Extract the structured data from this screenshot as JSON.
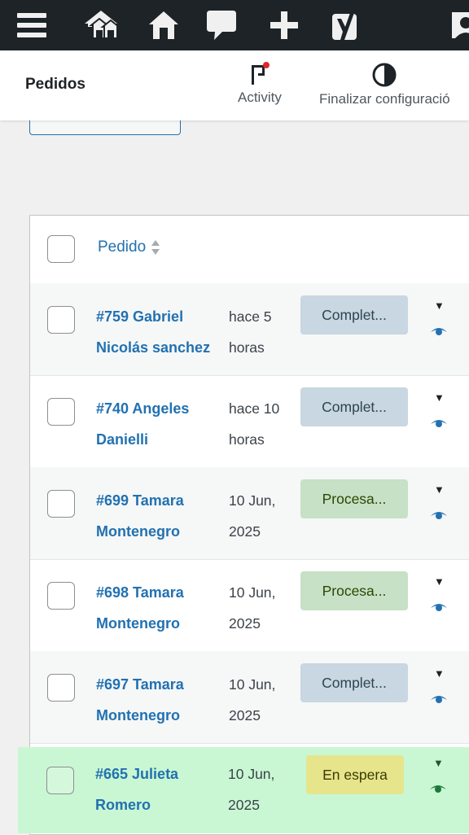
{
  "admin_bar": {
    "icons": [
      "menu-icon",
      "my-sites-icon",
      "home-icon",
      "comments-icon",
      "new-icon",
      "yoast-icon",
      "user-avatar-icon"
    ]
  },
  "header": {
    "title": "Pedidos",
    "activity_label": "Activity",
    "finish_label": "Finalizar configuració"
  },
  "table": {
    "column_order": "Pedido",
    "rows": [
      {
        "order_line1": "#759 Gabriel",
        "order_line2": "Nicolás sanchez",
        "date_line1": "hace 5",
        "date_line2": "horas",
        "status": "Complet...",
        "status_type": "completed"
      },
      {
        "order_line1": "#740 Angeles",
        "order_line2": "Danielli",
        "date_line1": "hace 10",
        "date_line2": "horas",
        "status": "Complet...",
        "status_type": "completed"
      },
      {
        "order_line1": "#699 Tamara",
        "order_line2": "Montenegro",
        "date_line1": "10 Jun,",
        "date_line2": "2025",
        "status": "Procesa...",
        "status_type": "processing"
      },
      {
        "order_line1": "#698 Tamara",
        "order_line2": "Montenegro",
        "date_line1": "10 Jun,",
        "date_line2": "2025",
        "status": "Procesa...",
        "status_type": "processing"
      },
      {
        "order_line1": "#697 Tamara",
        "order_line2": "Montenegro",
        "date_line1": "10 Jun,",
        "date_line2": "2025",
        "status": "Complet...",
        "status_type": "completed"
      },
      {
        "order_line1": "#665 Julieta",
        "order_line2": "Romero",
        "date_line1": "10 Jun,",
        "date_line2": "2025",
        "status": "En espera",
        "status_type": "on-hold"
      }
    ]
  },
  "colors": {
    "admin_bar": "#1d2327",
    "link": "#2271b1",
    "completed_bg": "#c8d7e1",
    "processing_bg": "#c6e1c6",
    "highlight_row": "#c9f7d3"
  }
}
